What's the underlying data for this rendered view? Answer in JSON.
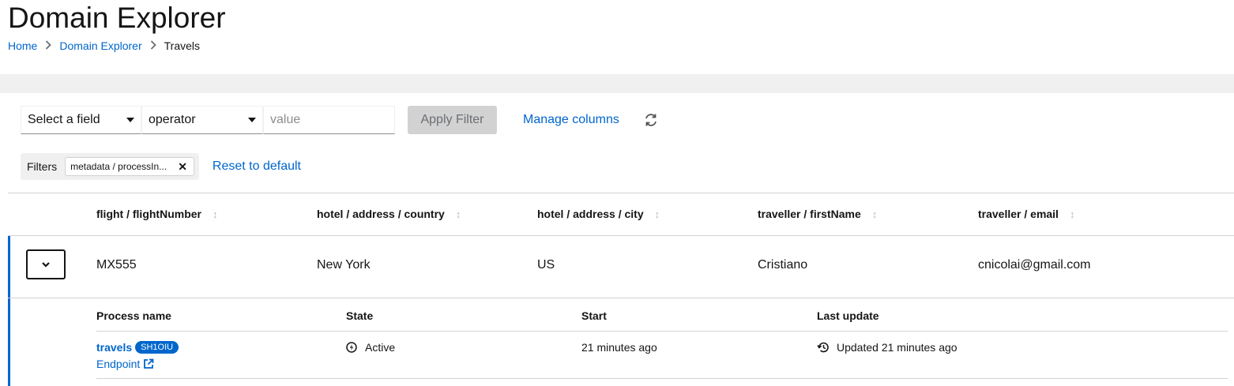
{
  "page": {
    "title": "Domain Explorer",
    "breadcrumb": [
      "Home",
      "Domain Explorer",
      "Travels"
    ]
  },
  "toolbar": {
    "field_select": "Select a field",
    "operator_select": "operator",
    "value_placeholder": "value",
    "apply_label": "Apply Filter",
    "manage_columns_label": "Manage columns",
    "refresh_icon": "sync-icon"
  },
  "filters": {
    "label": "Filters",
    "chips": [
      "metadata / processIn..."
    ],
    "reset_label": "Reset to default"
  },
  "table": {
    "columns": [
      "flight / flightNumber",
      "hotel / address / country",
      "hotel / address / city",
      "traveller / firstName",
      "traveller / email"
    ],
    "rows": [
      {
        "cells": [
          "MX555",
          "New York",
          "US",
          "Cristiano",
          "cnicolai@gmail.com"
        ],
        "expanded": true
      }
    ]
  },
  "details": {
    "columns": [
      "Process name",
      "State",
      "Start",
      "Last update"
    ],
    "rows": [
      {
        "process_name": "travels",
        "badge": "SH1OIU",
        "endpoint_label": "Endpoint",
        "state": "Active",
        "start": "21 minutes ago",
        "last_update": "Updated 21 minutes ago"
      }
    ]
  },
  "colors": {
    "link": "#0066cc",
    "accent": "#0066cc",
    "disabled_button": "#d2d2d2"
  }
}
